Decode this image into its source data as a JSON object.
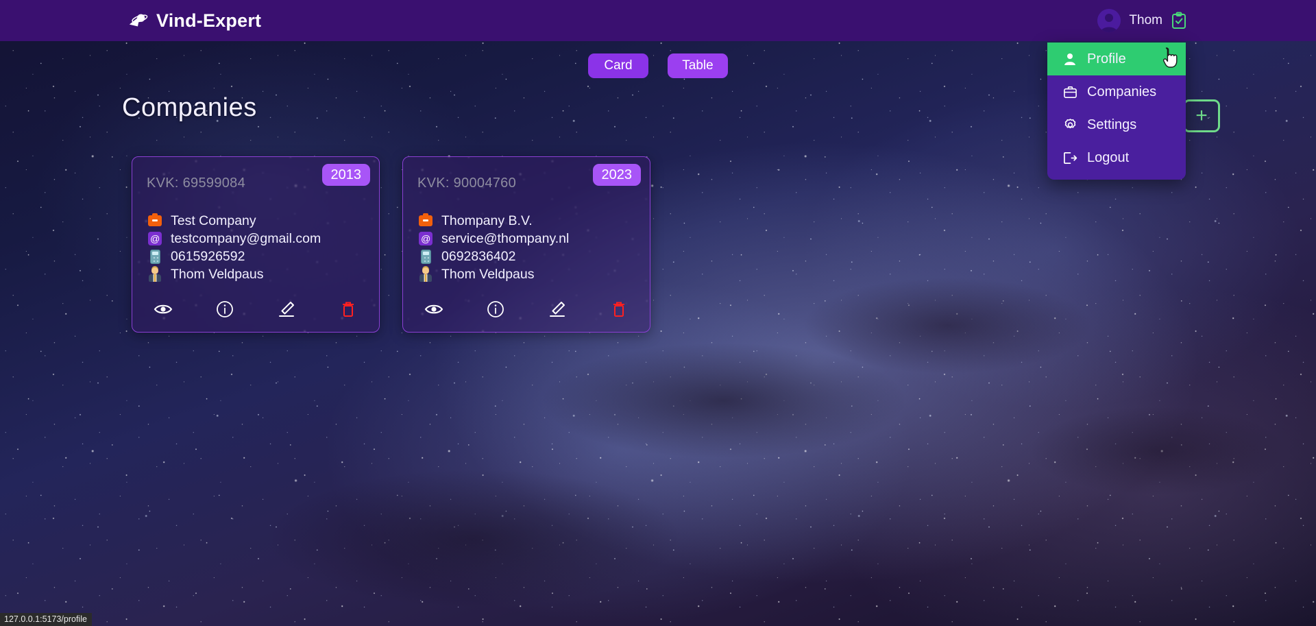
{
  "header": {
    "brand_name": "Vind-Expert",
    "brand_logo_icon": "comet-swoosh-icon",
    "user_name": "Thom",
    "avatar_icon": "user-avatar-icon",
    "clipboard_icon": "clipboard-check-icon"
  },
  "view_toggle": {
    "card_label": "Card",
    "table_label": "Table"
  },
  "page": {
    "title": "Companies",
    "add_label": "+"
  },
  "cards": [
    {
      "kvk": "KVK: 69599084",
      "year": "2013",
      "name": "Test Company",
      "email": "testcompany@gmail.com",
      "phone": "0615926592",
      "contact": "Thom Veldpaus",
      "actions": {
        "view": "view-icon",
        "info": "info-icon",
        "edit": "edit-icon",
        "delete": "delete-icon"
      }
    },
    {
      "kvk": "KVK: 90004760",
      "year": "2023",
      "name": "Thompany B.V.",
      "email": "service@thompany.nl",
      "phone": "0692836402",
      "contact": "Thom Veldpaus",
      "actions": {
        "view": "view-icon",
        "info": "info-icon",
        "edit": "edit-icon",
        "delete": "delete-icon"
      }
    }
  ],
  "user_menu": {
    "items": [
      {
        "label": "Profile",
        "icon": "person-icon",
        "active": true
      },
      {
        "label": "Companies",
        "icon": "briefcase-icon",
        "active": false
      },
      {
        "label": "Settings",
        "icon": "gear-icon",
        "active": false
      },
      {
        "label": "Logout",
        "icon": "logout-icon",
        "active": false
      }
    ]
  },
  "status_bar": {
    "url": "127.0.0.1:5173/profile"
  },
  "colors": {
    "header_bg": "#3a1070",
    "menu_bg": "#4a1f9e",
    "menu_active": "#2ecc71",
    "accent_purple": "#9b3ff0",
    "badge_purple": "#a855f7",
    "add_green": "#6fdb8a",
    "delete_red": "#ff2020",
    "card_border": "#8b3fd4"
  }
}
